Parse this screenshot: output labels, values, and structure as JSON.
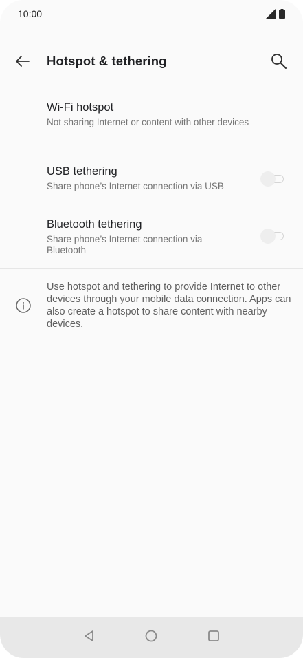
{
  "status_bar": {
    "time": "10:00",
    "icons": [
      "signal-icon",
      "battery-icon"
    ]
  },
  "toolbar": {
    "title": "Hotspot & tethering",
    "back_icon": "arrow-left-icon",
    "search_icon": "search-icon"
  },
  "settings": {
    "items": [
      {
        "title": "Wi-Fi hotspot",
        "summary": "Not sharing Internet or content with other devices",
        "has_toggle": false
      },
      {
        "title": "USB tethering",
        "summary": "Share phone’s Internet connection via USB",
        "has_toggle": true,
        "toggle_on": false
      },
      {
        "title": "Bluetooth tethering",
        "summary": "Share phone’s Internet connection via Bluetooth",
        "summary_line1": "Share phone’s Internet connection via",
        "summary_line2": "Bluetooth",
        "has_toggle": true,
        "toggle_on": false
      }
    ]
  },
  "info": {
    "icon": "info-icon",
    "text": "Use hotspot and tethering to provide Internet to other devices through your mobile data connection. Apps can also create a hotspot to share content with nearby devices."
  },
  "nav_bar": {
    "buttons": [
      "back-triangle-icon",
      "home-circle-icon",
      "recents-square-icon"
    ]
  },
  "colors": {
    "background": "#fafafa",
    "text_primary": "#202124",
    "text_secondary": "#757575",
    "toggle_off_thumb": "#eeeeee",
    "nav_bar": "#e8e8e8"
  }
}
